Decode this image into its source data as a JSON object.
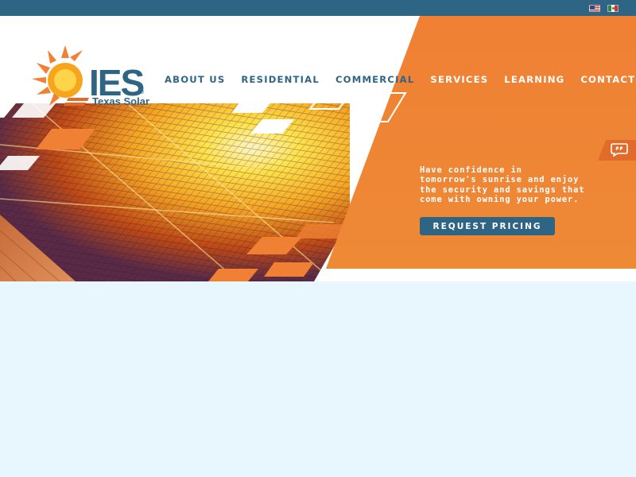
{
  "brand": {
    "logo_text": "IES",
    "logo_sub": "Texas Solar",
    "logo_reg": "®"
  },
  "languages": [
    {
      "name": "English",
      "icon": "us-flag-icon"
    },
    {
      "name": "Español",
      "icon": "mexico-flag-icon"
    }
  ],
  "nav": {
    "items": [
      {
        "label": "ABOUT US"
      },
      {
        "label": "RESIDENTIAL"
      },
      {
        "label": "COMMERCIAL"
      },
      {
        "label": "SERVICES"
      },
      {
        "label": "LEARNING"
      },
      {
        "label": "CONTACT US"
      }
    ]
  },
  "hero": {
    "tagline_lines": [
      "Have confidence in",
      "tomorrow's sunrise and enjoy",
      "the security and savings that",
      "come with owning your power."
    ],
    "cta_label": "REQUEST PRICING",
    "chat_icon": "quote-bubble-icon"
  },
  "colors": {
    "topbar": "#2f6584",
    "brand_blue": "#2f6584",
    "brand_orange": "#ef8034",
    "page_bg": "#e8f6fd"
  }
}
